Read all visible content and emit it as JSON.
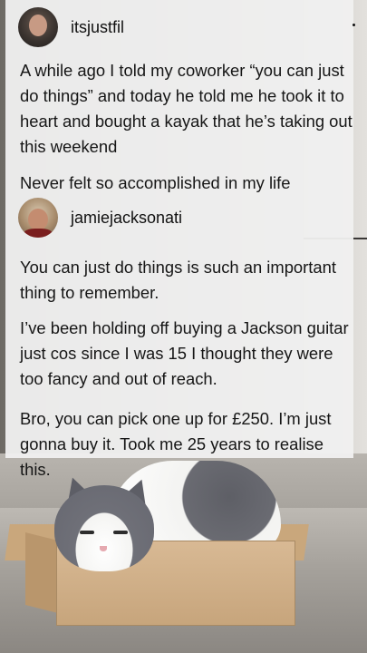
{
  "post": {
    "username": "itsjustfil",
    "paragraphs": [
      "A while ago I told my coworker “you can just do things” and today he told me he took it to heart and bought a kayak that he’s taking out this weekend",
      "Never felt so accomplished in my life"
    ]
  },
  "reply": {
    "username": "jamiejacksonati",
    "paragraphs": [
      "You can just do things is such an important thing to remember.",
      "I’ve been holding off buying a Jackson guitar just cos since I was 15 I thought they were too fancy and out of reach.",
      "Bro, you can pick one up for £250. I’m just gonna buy it. Took me 25 years to realise this."
    ]
  },
  "icons": {
    "post_avatar": "user-avatar",
    "reply_avatar": "user-avatar",
    "more": "more-options-icon"
  }
}
